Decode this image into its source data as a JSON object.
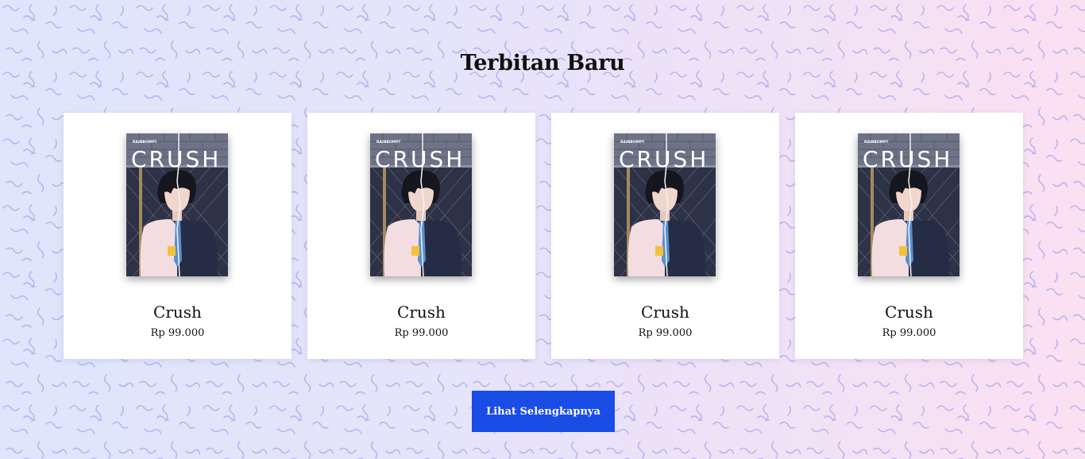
{
  "section": {
    "title": "Terbitan Baru"
  },
  "books": [
    {
      "title": "Crush",
      "price": "Rp 99.000",
      "cover_author": "RAINBOMPT",
      "cover_title": "CRUSH"
    },
    {
      "title": "Crush",
      "price": "Rp 99.000",
      "cover_author": "RAINBOMPT",
      "cover_title": "CRUSH"
    },
    {
      "title": "Crush",
      "price": "Rp 99.000",
      "cover_author": "RAINBOMPT",
      "cover_title": "CRUSH"
    },
    {
      "title": "Crush",
      "price": "Rp 99.000",
      "cover_author": "RAINBOMPT",
      "cover_title": "CRUSH"
    }
  ],
  "more_button": {
    "label": "Lihat Selengkapnya"
  },
  "colors": {
    "button": "#1a4ce6",
    "pattern_stroke": "#a9a8ea",
    "background_left": "#dde6fb",
    "background_right": "#fbe0f1"
  }
}
